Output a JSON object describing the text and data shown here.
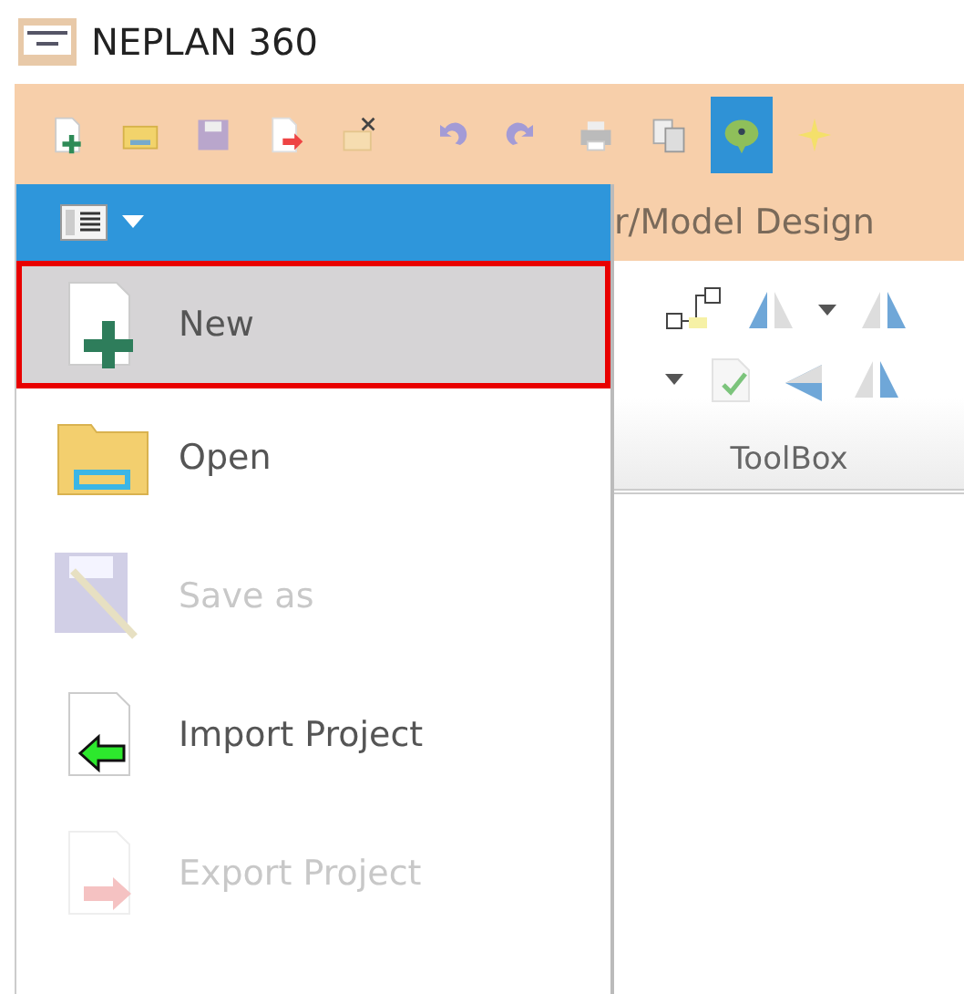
{
  "window": {
    "title": "NEPLAN 360"
  },
  "toolbar": [
    {
      "selected": false
    },
    {
      "selected": false
    },
    {
      "selected": false
    },
    {
      "selected": false
    },
    {
      "selected": false
    },
    {
      "selected": false
    },
    {
      "selected": false
    },
    {
      "selected": false
    },
    {
      "selected": false
    },
    {
      "selected": true
    },
    {
      "selected": false
    }
  ],
  "tab": {
    "label": "r/Model Design"
  },
  "ribbon": {
    "group_label": "ToolBox"
  },
  "menu": {
    "items": [
      {
        "label": "New",
        "selected": true,
        "disabled": false
      },
      {
        "label": "Open",
        "selected": false,
        "disabled": false
      },
      {
        "label": "Save as",
        "selected": false,
        "disabled": true
      },
      {
        "label": "Import Project",
        "selected": false,
        "disabled": false
      },
      {
        "label": "Export Project",
        "selected": false,
        "disabled": true
      }
    ]
  }
}
